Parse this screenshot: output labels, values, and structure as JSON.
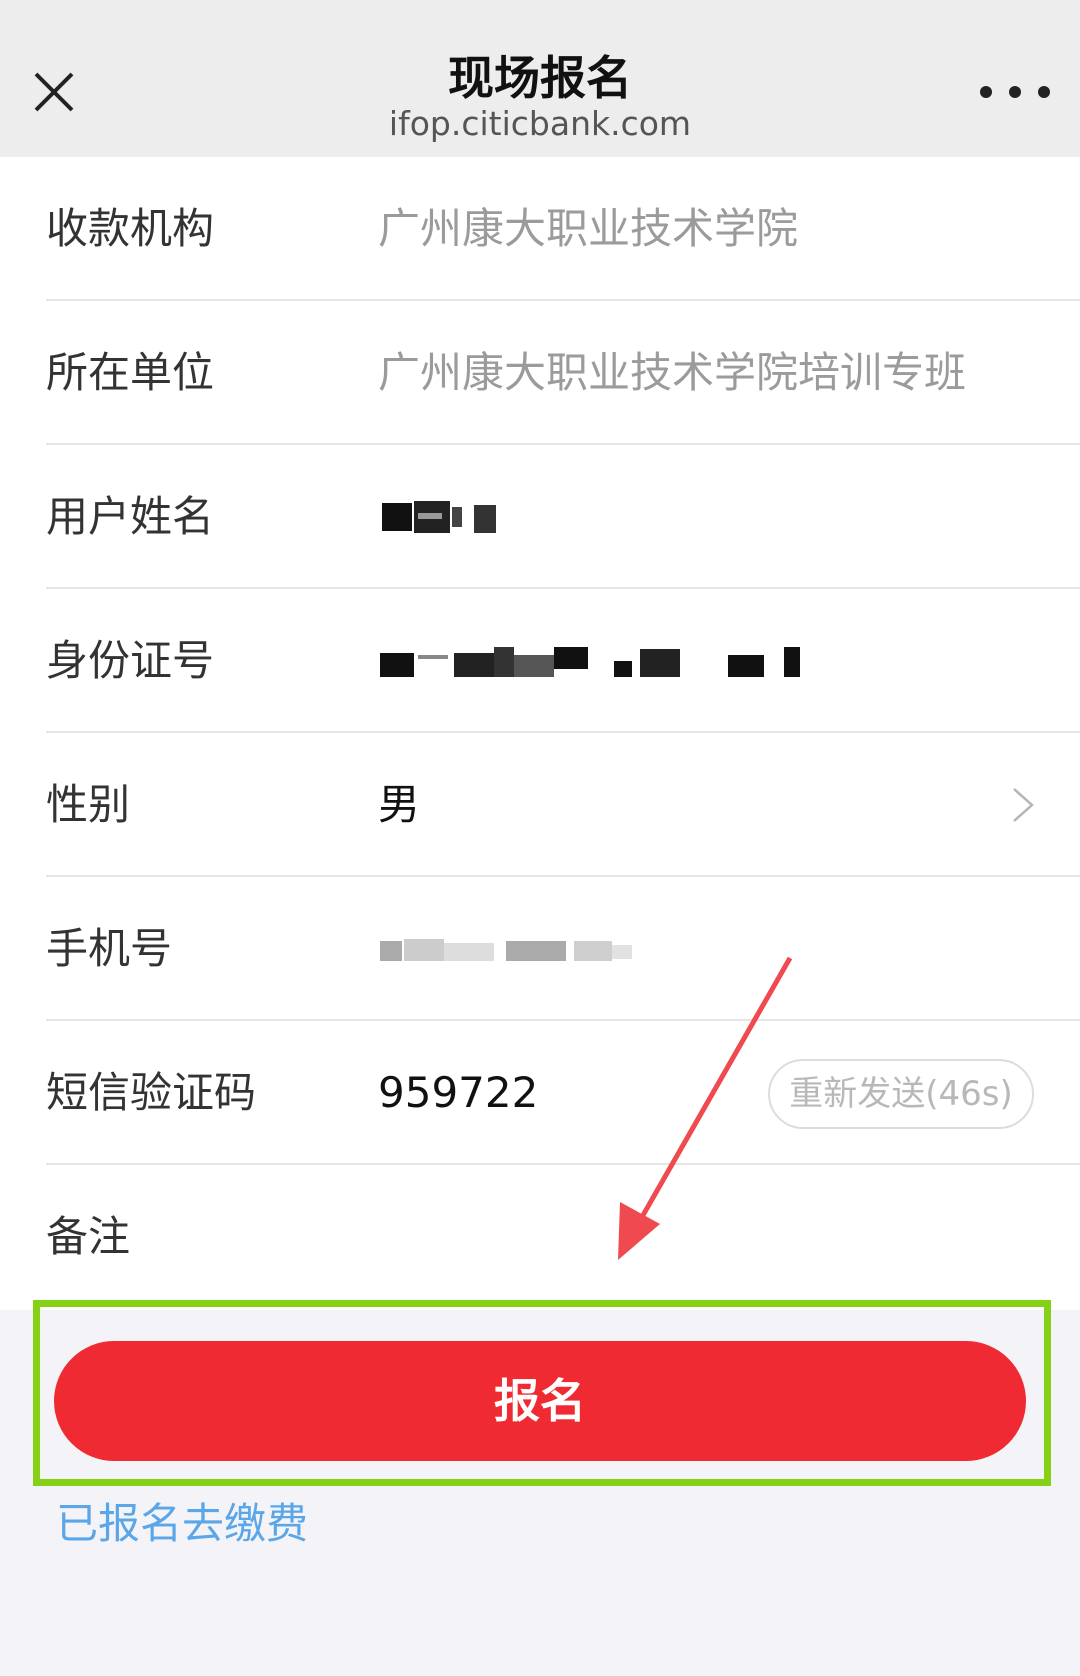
{
  "header": {
    "title": "现场报名",
    "domain": "ifop.citicbank.com",
    "close_icon": "close-icon",
    "more_icon": "more-icon"
  },
  "form": {
    "rows": [
      {
        "label": "收款机构",
        "value": "广州康大职业技术学院"
      },
      {
        "label": "所在单位",
        "value": "广州康大职业技术学院培训专班"
      },
      {
        "label": "用户姓名",
        "value": ""
      },
      {
        "label": "身份证号",
        "value": ""
      },
      {
        "label": "性别",
        "value": "男"
      },
      {
        "label": "手机号",
        "value": ""
      },
      {
        "label": "短信验证码",
        "value": "959722"
      },
      {
        "label": "备注",
        "value": ""
      }
    ],
    "resend_label": "重新发送(46s)"
  },
  "actions": {
    "submit_label": "报名",
    "pay_link": "已报名去缴费"
  },
  "colors": {
    "primary_button": "#f02a32",
    "highlight_border": "#86d016",
    "link": "#5aa6e8",
    "annotation_arrow": "#ef4a4f"
  }
}
